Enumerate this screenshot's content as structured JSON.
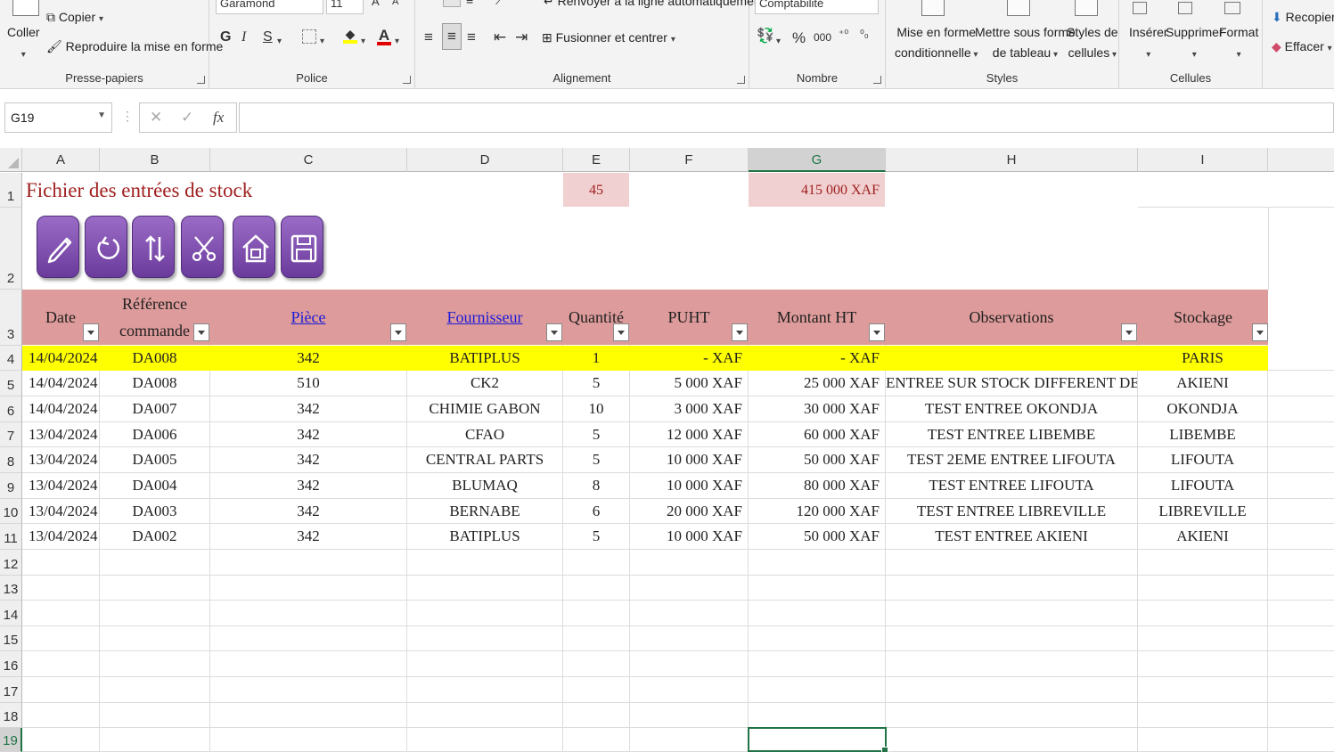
{
  "ribbon": {
    "clipboard": {
      "label": "Presse-papiers",
      "paste": "Coller",
      "copy": "Copier",
      "format_painter": "Reproduire la mise en forme"
    },
    "font": {
      "label": "Police",
      "family": "Garamond",
      "size": "11",
      "bold": "G",
      "italic": "I",
      "underline": "S"
    },
    "alignment": {
      "label": "Alignement",
      "wrap": "Renvoyer à la ligne automatiquement",
      "merge": "Fusionner et centrer"
    },
    "number": {
      "label": "Nombre",
      "format": "Comptabilité",
      "percent": "%",
      "thousands": "000"
    },
    "styles": {
      "label": "Styles",
      "conditional_1": "Mise en forme",
      "conditional_2": "conditionnelle",
      "table_1": "Mettre sous forme",
      "table_2": "de tableau",
      "cell_1": "Styles de",
      "cell_2": "cellules"
    },
    "cells": {
      "label": "Cellules",
      "insert": "Insérer",
      "delete": "Supprimer",
      "format": "Format"
    },
    "editing": {
      "fill": "Recopier",
      "clear": "Effacer"
    }
  },
  "formula_bar": {
    "name_box": "G19",
    "fx": "fx",
    "value": ""
  },
  "columns": [
    "A",
    "B",
    "C",
    "D",
    "E",
    "F",
    "G",
    "H",
    "I"
  ],
  "rows": [
    "1",
    "2",
    "3",
    "4",
    "5",
    "6",
    "7",
    "8",
    "9",
    "10",
    "11",
    "12",
    "13",
    "14",
    "15",
    "16",
    "17",
    "18",
    "19"
  ],
  "sheet": {
    "title": "Fichier des entrées de stock",
    "count": "45",
    "total": "415 000 XAF",
    "headers": {
      "date": "Date",
      "ref_1": "Référence",
      "ref_2": "commande",
      "piece": "Pièce",
      "fournisseur": "Fournisseur",
      "quantite": "Quantité",
      "puht": "PUHT",
      "montant": "Montant HT",
      "observations": "Observations",
      "stockage": "Stockage"
    },
    "data": [
      [
        "14/04/2024",
        "DA008",
        "342",
        "BATIPLUS",
        "1",
        "- XAF",
        "- XAF",
        "",
        "PARIS"
      ],
      [
        "14/04/2024",
        "DA008",
        "510",
        "CK2",
        "5",
        "5 000 XAF",
        "25 000 XAF",
        "ENTREE SUR STOCK DIFFERENT DE INVE",
        "AKIENI"
      ],
      [
        "14/04/2024",
        "DA007",
        "342",
        "CHIMIE GABON",
        "10",
        "3 000 XAF",
        "30 000 XAF",
        "TEST ENTREE OKONDJA",
        "OKONDJA"
      ],
      [
        "13/04/2024",
        "DA006",
        "342",
        "CFAO",
        "5",
        "12 000 XAF",
        "60 000 XAF",
        "TEST ENTREE LIBEMBE",
        "LIBEMBE"
      ],
      [
        "13/04/2024",
        "DA005",
        "342",
        "CENTRAL PARTS",
        "5",
        "10 000 XAF",
        "50 000 XAF",
        "TEST 2EME ENTREE LIFOUTA",
        "LIFOUTA"
      ],
      [
        "13/04/2024",
        "DA004",
        "342",
        "BLUMAQ",
        "8",
        "10 000 XAF",
        "80 000 XAF",
        "TEST ENTREE LIFOUTA",
        "LIFOUTA"
      ],
      [
        "13/04/2024",
        "DA003",
        "342",
        "BERNABE",
        "6",
        "20 000 XAF",
        "120 000 XAF",
        "TEST ENTREE LIBREVILLE",
        "LIBREVILLE"
      ],
      [
        "13/04/2024",
        "DA002",
        "342",
        "BATIPLUS",
        "5",
        "10 000 XAF",
        "50 000 XAF",
        "TEST ENTREE AKIENI",
        "AKIENI"
      ]
    ],
    "macro_buttons": [
      "pencil-icon",
      "refresh-icon",
      "sort-icon",
      "scissors-icon",
      "house-icon",
      "save-icon"
    ]
  },
  "colors": {
    "header_band": "#de9b9b",
    "highlight_row": "#ffff00",
    "title": "#a02020",
    "selection": "#217346"
  }
}
